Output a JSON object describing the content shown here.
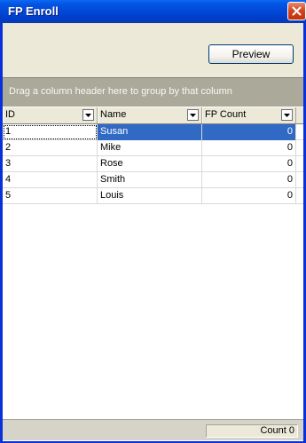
{
  "window": {
    "title": "FP Enroll"
  },
  "toolbar": {
    "preview_label": "Preview"
  },
  "grid": {
    "group_hint": "Drag a column header here to group by that column",
    "columns": [
      "ID",
      "Name",
      "FP Count"
    ],
    "rows": [
      {
        "id": "1",
        "name": "Susan",
        "fp_count": "0",
        "selected": true
      },
      {
        "id": "2",
        "name": "Mike",
        "fp_count": "0"
      },
      {
        "id": "3",
        "name": "Rose",
        "fp_count": "0"
      },
      {
        "id": "4",
        "name": "Smith",
        "fp_count": "0"
      },
      {
        "id": "5",
        "name": "Louis",
        "fp_count": "0"
      }
    ]
  },
  "footer": {
    "count_text": "Count 0"
  },
  "colors": {
    "title_bar": "#0046d6",
    "selection": "#316ac5",
    "group_area": "#aaa99a",
    "window_bg": "#ece9d8"
  },
  "icons": {
    "close": "close-icon",
    "dropdown": "dropdown-arrow-icon"
  }
}
